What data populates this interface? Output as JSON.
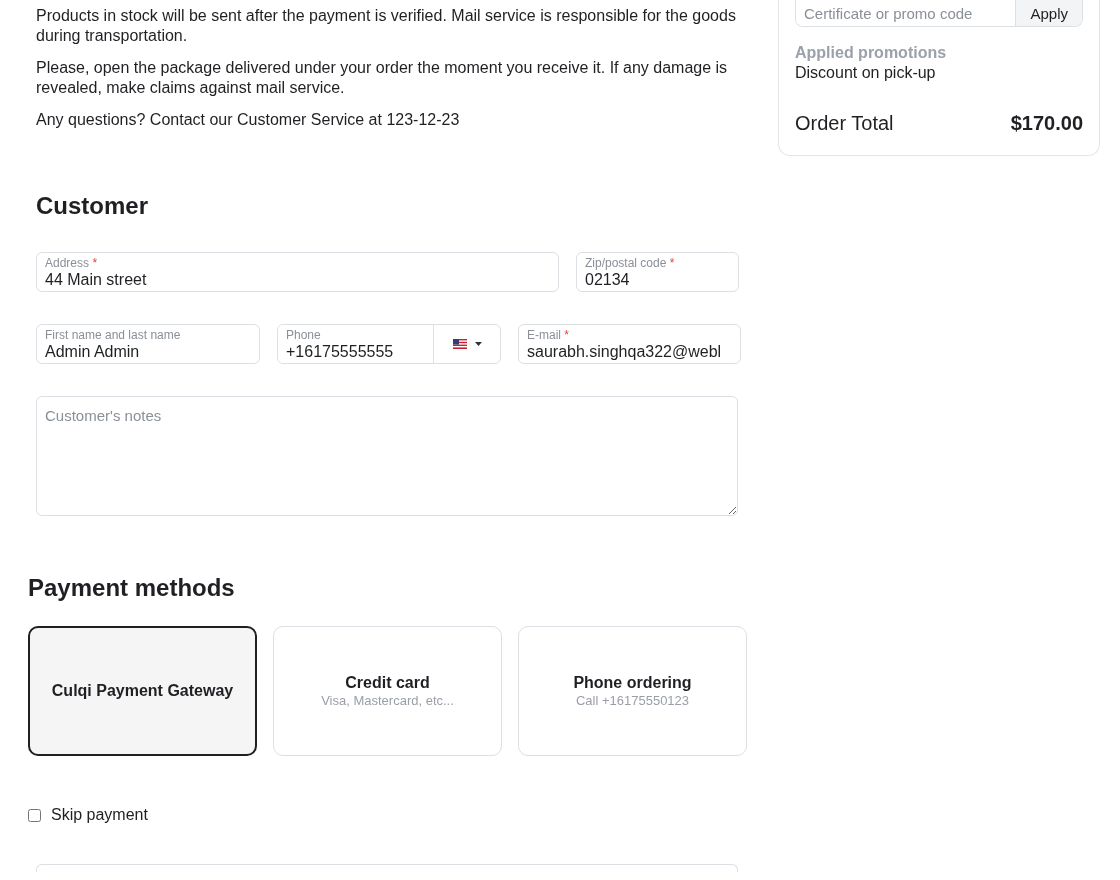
{
  "delivery_notes": [
    "Products in stock will be sent after the payment is verified. Mail service is responsible for the goods during transportation.",
    "Please, open the package delivered under your order the moment you receive it. If any damage is revealed, make claims against mail service.",
    "Any questions? Contact our Customer Service at 123-12-23"
  ],
  "customer": {
    "title": "Customer",
    "fields": [
      {
        "kind": "text",
        "label": "Address",
        "required_mark": "*",
        "value": "44 Main street"
      },
      {
        "kind": "text",
        "label": "Zip/postal code",
        "required_mark": "*",
        "value": "02134"
      },
      {
        "kind": "text",
        "label": "First name and last name",
        "value": "Admin Admin"
      },
      {
        "kind": "phone",
        "label": "Phone",
        "value": "+16175555555"
      },
      {
        "kind": "text",
        "label": "E-mail",
        "required_mark": "*",
        "value": "saurabh.singhqa322@webl"
      }
    ],
    "notes": {
      "placeholder": "Customer's notes"
    }
  },
  "payment": {
    "title": "Payment methods",
    "methods": [
      {
        "name": "Culqi Payment Gateway",
        "selected": true
      },
      {
        "name": "Credit card",
        "description": "Visa, Mastercard, etc...",
        "selected": false
      },
      {
        "name": "Phone ordering",
        "description": "Call +16175550123",
        "selected": false
      }
    ],
    "skip_payment": {
      "label": "Skip payment",
      "checked": false
    }
  },
  "order_summary": {
    "promo_field": {
      "placeholder": "Certificate or promo code"
    },
    "apply_button": "Apply",
    "promotions_heading": "Applied promotions",
    "promotions": [
      "Discount on pick-up"
    ],
    "total_label": "Order Total",
    "total_value": "$170.00"
  }
}
